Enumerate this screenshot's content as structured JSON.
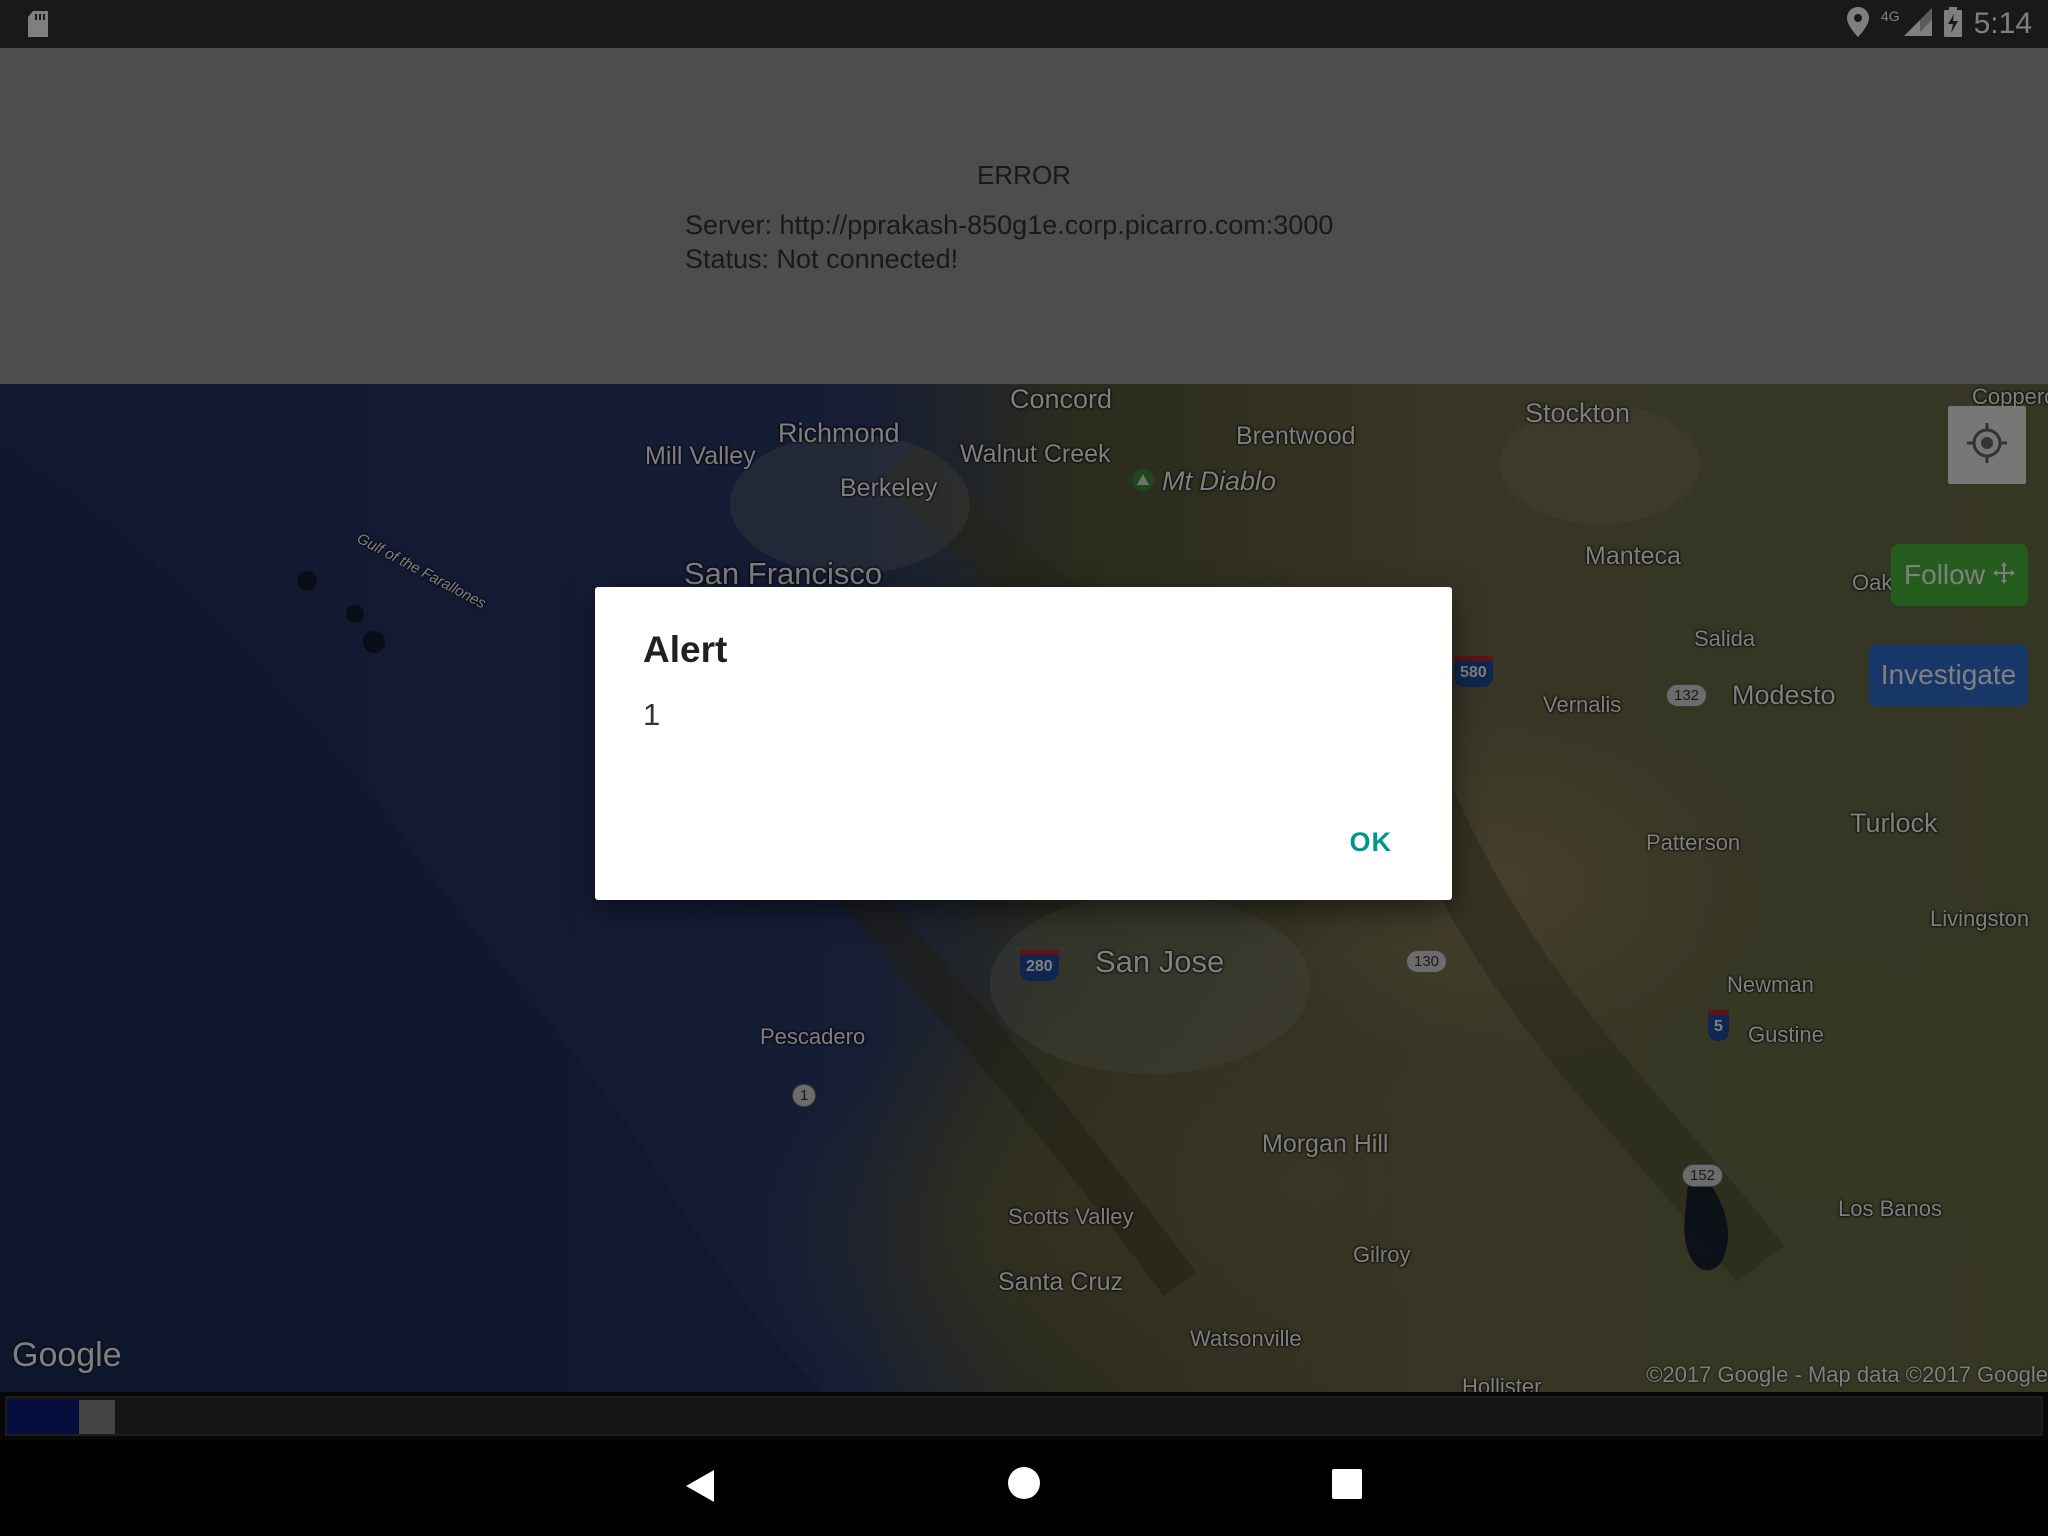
{
  "status_bar": {
    "time": "5:14",
    "network_label": "4G",
    "icons": [
      "sd-card-icon",
      "location-icon",
      "cell-signal-icon",
      "battery-charging-icon"
    ]
  },
  "header": {
    "error_title": "ERROR",
    "server_line": "Server: http://pprakash-850g1e.corp.picarro.com:3000",
    "status_line": "Status: Not connected!"
  },
  "map": {
    "labels": {
      "concord": "Concord",
      "richmond": "Richmond",
      "mill_valley": "Mill Valley",
      "walnut_creek": "Walnut Creek",
      "berkeley": "Berkeley",
      "mt_diablo": "Mt Diablo",
      "brentwood": "Brentwood",
      "stockton": "Stockton",
      "copperopolis": "Copperc",
      "gulf_farallones": "Gulf of the Farallones",
      "san_francisco": "San Francisco",
      "manteca": "Manteca",
      "oakdale": "Oak",
      "salida": "Salida",
      "vernalis": "Vernalis",
      "modesto": "Modesto",
      "turlock": "Turlock",
      "patterson": "Patterson",
      "livingston": "Livingston",
      "san_jose": "San Jose",
      "newman": "Newman",
      "gustine": "Gustine",
      "pescadero": "Pescadero",
      "morgan_hill": "Morgan Hill",
      "scotts_valley": "Scotts Valley",
      "los_banos": "Los Banos",
      "gilroy": "Gilroy",
      "santa_cruz": "Santa Cruz",
      "watsonville": "Watsonville",
      "hollister": "Hollister"
    },
    "shields": {
      "i580": "580",
      "r132": "132",
      "i280": "280",
      "r130": "130",
      "i5": "5",
      "r1": "1",
      "r152": "152"
    },
    "follow_label": "Follow",
    "investigate_label": "Investigate",
    "logo_text": "Google",
    "copyright": "©2017 Google - Map data ©2017 Google"
  },
  "dialog": {
    "title": "Alert",
    "message": "1",
    "ok_label": "OK"
  },
  "colors": {
    "follow": "#48b83a",
    "investigate": "#2f6fd1",
    "dialog_ok": "#009688"
  }
}
